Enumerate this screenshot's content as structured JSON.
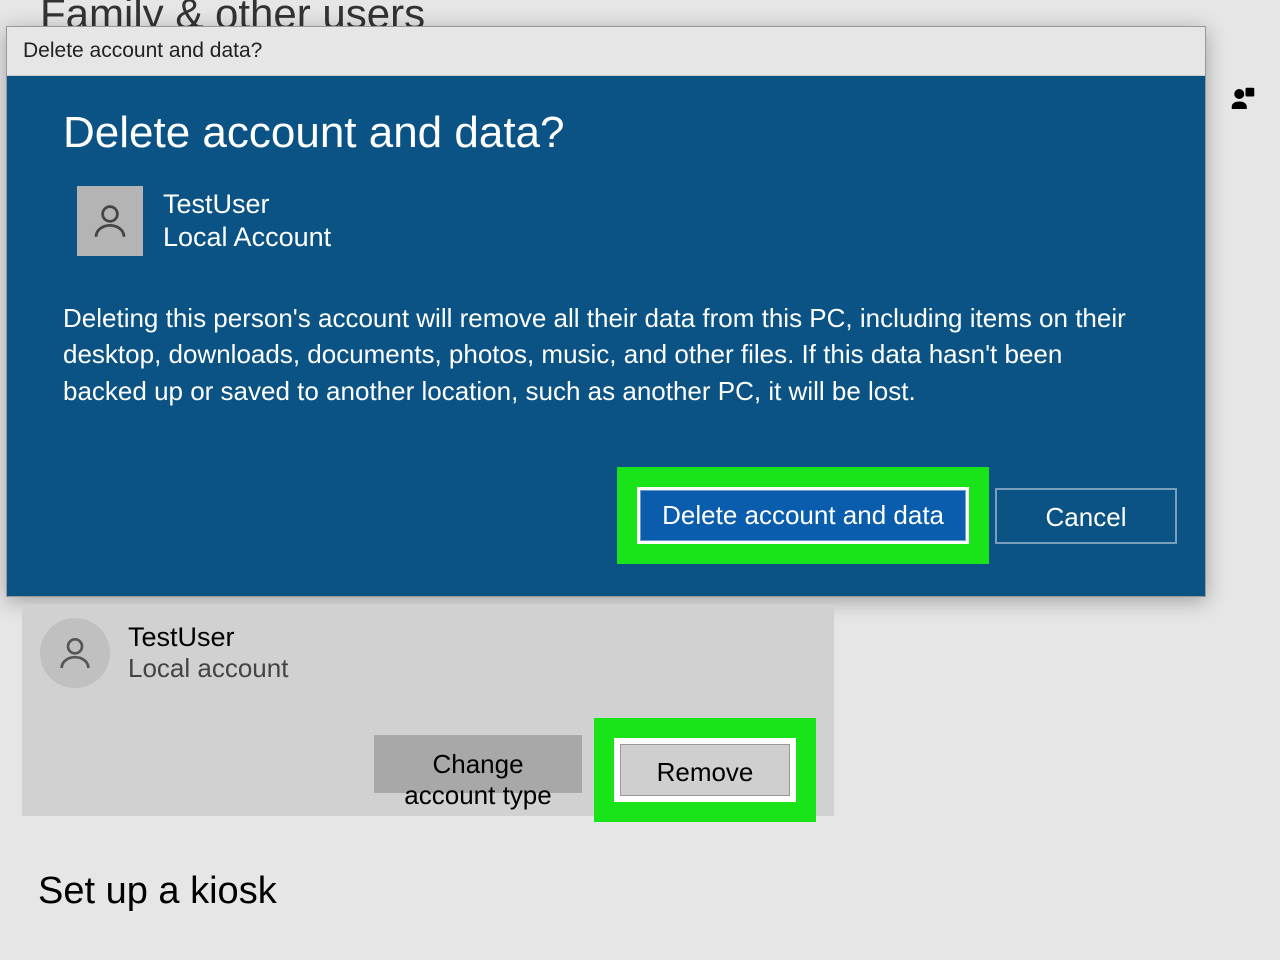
{
  "page": {
    "heading": "Family & other users",
    "kiosk_heading": "Set up a kiosk"
  },
  "dialog": {
    "titlebar": "Delete account and data?",
    "heading": "Delete account and data?",
    "user": {
      "name": "TestUser",
      "type": "Local Account"
    },
    "message": "Deleting this person's account will remove all their data from this PC, including items on their desktop, downloads, documents, photos, music, and other files. If this data hasn't been backed up or saved to another location, such as another PC, it will be lost.",
    "primary_button": "Delete account and data",
    "secondary_button": "Cancel"
  },
  "user_card": {
    "name": "TestUser",
    "type": "Local account",
    "change_button": "Change account type",
    "remove_button": "Remove"
  }
}
